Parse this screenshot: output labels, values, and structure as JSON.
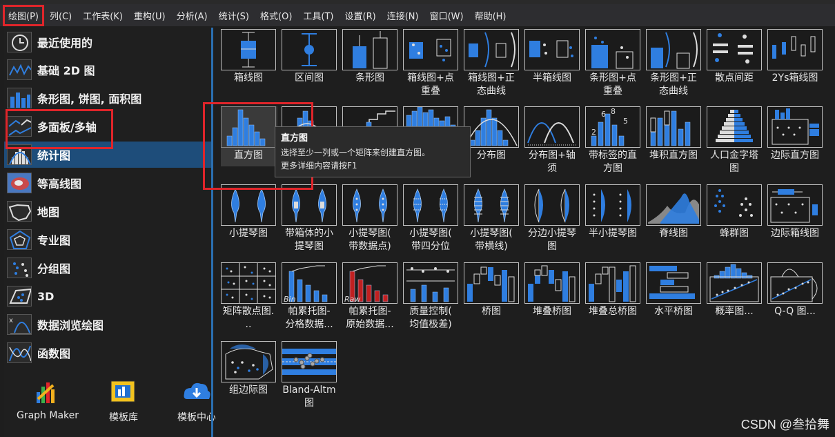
{
  "menu": [
    "绘图(P)",
    "列(C)",
    "工作表(K)",
    "重构(U)",
    "分析(A)",
    "统计(S)",
    "格式(O)",
    "工具(T)",
    "设置(R)",
    "连接(N)",
    "窗口(W)",
    "帮助(H)"
  ],
  "categories": [
    "最近使用的",
    "基础 2D 图",
    "条形图, 饼图, 面积图",
    "多面板/多轴",
    "统计图",
    "等高线图",
    "地图",
    "专业图",
    "分组图",
    "3D",
    "数据浏览绘图",
    "函数图"
  ],
  "selected_category": "统计图",
  "bottom_tools": [
    "Graph Maker",
    "模板库",
    "模板中心"
  ],
  "tiles": [
    [
      "箱线图"
    ],
    [
      "区间图"
    ],
    [
      "条形图"
    ],
    [
      "箱线图+点",
      "重叠"
    ],
    [
      "箱线图+正",
      "态曲线"
    ],
    [
      "半箱线图"
    ],
    [
      "条形图+点",
      "重叠"
    ],
    [
      "条形图+正",
      "态曲线"
    ],
    [
      "散点间距"
    ],
    [
      "2Ys箱线图"
    ],
    [
      "直方图"
    ],
    [
      ""
    ],
    [
      ""
    ],
    [
      ""
    ],
    [
      "分布图"
    ],
    [
      "分布图+轴",
      "须"
    ],
    [
      "带标签的直",
      "方图"
    ],
    [
      "堆积直方图"
    ],
    [
      "人口金字塔",
      "图"
    ],
    [
      "边际直方图"
    ],
    [
      "小提琴图"
    ],
    [
      "带箱体的小",
      "提琴图"
    ],
    [
      "小提琴图(",
      "带数据点)"
    ],
    [
      "小提琴图(",
      "带四分位"
    ],
    [
      "小提琴图(",
      "带横线)"
    ],
    [
      "分边小提琴",
      "图"
    ],
    [
      "半小提琴图"
    ],
    [
      "脊线图"
    ],
    [
      "蜂群图"
    ],
    [
      "边际箱线图"
    ],
    [
      "矩阵散点图.",
      ".."
    ],
    [
      "帕累托图-",
      "分格数据..."
    ],
    [
      "帕累托图-",
      "原始数据..."
    ],
    [
      "质量控制(",
      "均值极差)"
    ],
    [
      "桥图"
    ],
    [
      "堆叠桥图"
    ],
    [
      "堆叠总桥图"
    ],
    [
      "水平桥图"
    ],
    [
      "概率图..."
    ],
    [
      "Q-Q 图..."
    ],
    [
      "组边际图"
    ],
    [
      "Bland-Altm",
      "图"
    ]
  ],
  "tooltip": {
    "title": "直方图",
    "line1": "选择至少一列或一个矩阵来创建直方图。",
    "line2": "更多详细内容请按F1"
  },
  "thumb_labels": {
    "bin": "Bin",
    "raw": "Raw",
    "hist_labels": [
      "2",
      "6",
      "8",
      "5"
    ]
  },
  "watermark": "CSDN @叁拾舞",
  "colors": {
    "accent": "#1f6fd0",
    "highlight": "#e0252a",
    "selected": "#1e4d7a"
  }
}
